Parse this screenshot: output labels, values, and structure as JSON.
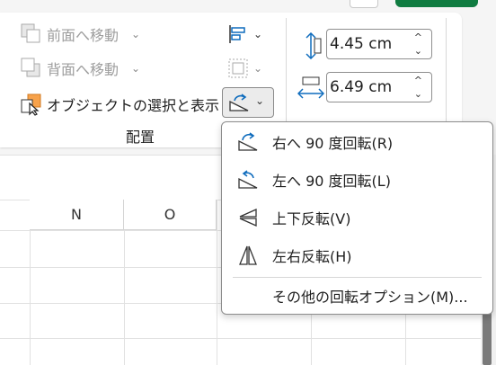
{
  "ribbon": {
    "bring_forward": "前面へ移動",
    "send_backward": "背面へ移動",
    "selection_pane": "オブジェクトの選択と表示",
    "group_label": "配置",
    "height_value": "4.45 cm",
    "width_value": "6.49 cm"
  },
  "sheet": {
    "columns": [
      "N",
      "O"
    ]
  },
  "rotate_menu": {
    "items": [
      {
        "label": "右へ 90 度回転(R)",
        "icon": "rotate-right-icon"
      },
      {
        "label": "左へ 90 度回転(L)",
        "icon": "rotate-left-icon"
      },
      {
        "label": "上下反転(V)",
        "icon": "flip-vertical-icon"
      },
      {
        "label": "左右反転(H)",
        "icon": "flip-horizontal-icon"
      }
    ],
    "more_options": "その他の回転オプション(M)..."
  },
  "colors": {
    "accent_blue": "#0f6cbd",
    "brand_green": "#107c41",
    "orange": "#f7a24b"
  }
}
